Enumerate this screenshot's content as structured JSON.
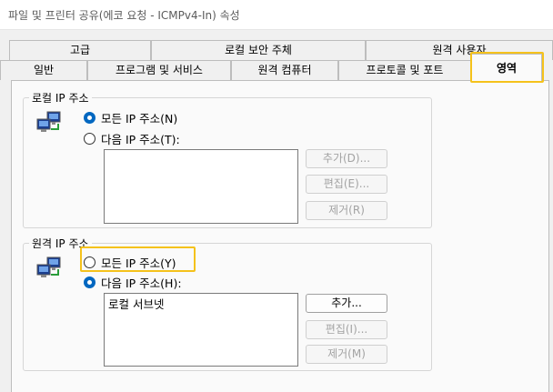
{
  "window": {
    "title": "파일 및 프린터 공유(에코 요청 - ICMPv4-In) 속성"
  },
  "tabs": {
    "row_back": [
      "고급",
      "로컬 보안 주체",
      "원격 사용자"
    ],
    "row_front": [
      "일반",
      "프로그램 및 서비스",
      "원격 컴퓨터",
      "프로토콜 및 포트",
      "영역"
    ],
    "selected": "영역"
  },
  "local_ip": {
    "label": "로컬 IP 주소",
    "option_any": "모든 IP 주소(N)",
    "option_these": "다음 IP 주소(T):",
    "selected": "any",
    "list_items": [],
    "buttons": {
      "add": "추가(D)...",
      "edit": "편집(E)...",
      "remove": "제거(R)"
    }
  },
  "remote_ip": {
    "label": "원격 IP 주소",
    "option_any": "모든 IP 주소(Y)",
    "option_these": "다음 IP 주소(H):",
    "selected": "these",
    "list_items": [
      "로컬 서브넷"
    ],
    "buttons": {
      "add": "추가...",
      "edit": "편집(I)...",
      "remove": "제거(M)"
    }
  },
  "colors": {
    "highlight": "#f5c21b",
    "accent": "#0067c0"
  },
  "icons": {
    "network": "network-computers-icon"
  }
}
